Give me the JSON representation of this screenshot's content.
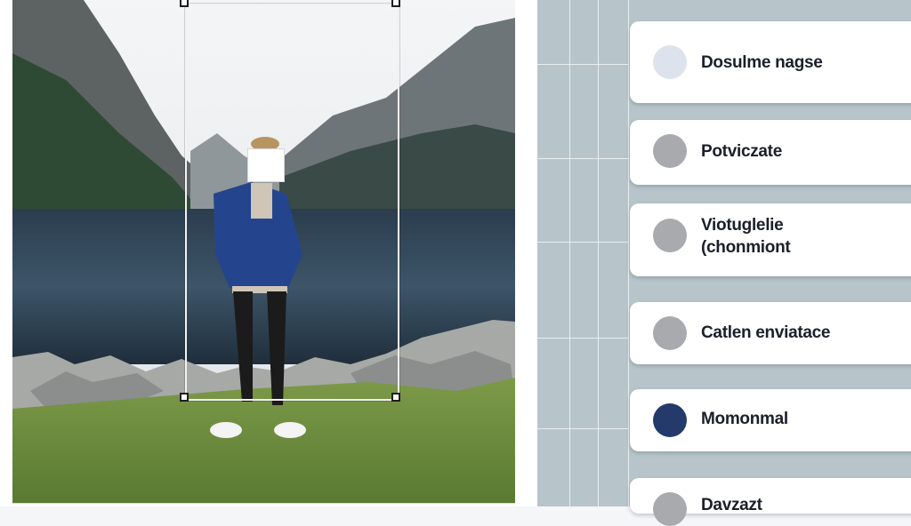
{
  "style_options": [
    {
      "label": "Dosulme nagse",
      "dot_color": "#dde3ec",
      "selected": false
    },
    {
      "label": "Potviczate",
      "dot_color": "#a9aaad",
      "selected": false
    },
    {
      "label": "Viotuglelie\n(chonmiont",
      "dot_color": "#a9aaad",
      "selected": false
    },
    {
      "label": "Catlen enviatace",
      "dot_color": "#a9aaad",
      "selected": false
    },
    {
      "label": "Momonmal",
      "dot_color": "#243a6b",
      "selected": true
    },
    {
      "label": "Davzazt",
      "dot_color": "#a9aaad",
      "selected": false
    }
  ],
  "colors": {
    "panel_bg": "#b7c5cb",
    "selected_dot": "#243a6b",
    "crop_frame": "#f2f2f2"
  }
}
